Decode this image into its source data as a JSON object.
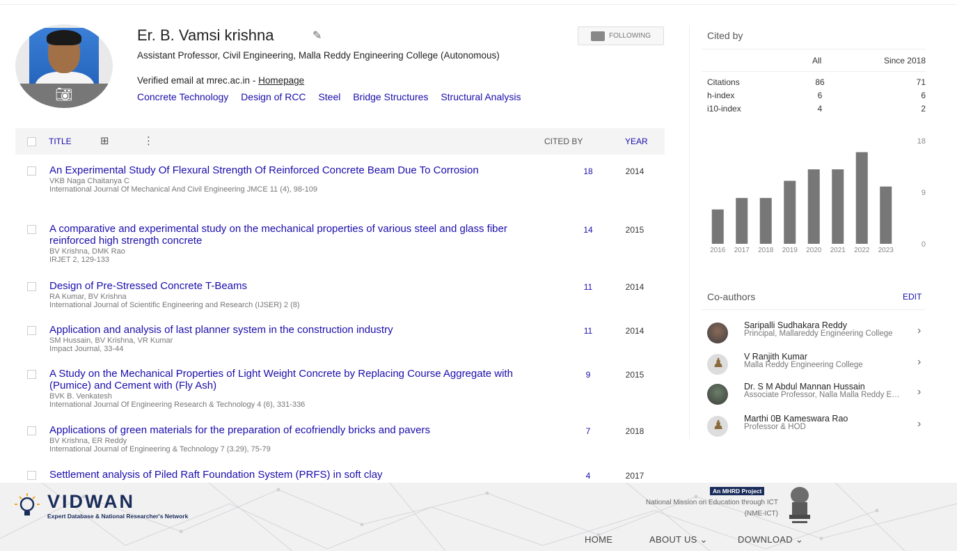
{
  "profile": {
    "name": "Er. B. Vamsi krishna",
    "affiliation": "Assistant Professor, Civil Engineering, Malla Reddy Engineering College (Autonomous)",
    "email_prefix": "Verified email at mrec.ac.in - ",
    "homepage_label": "Homepage",
    "interests": [
      "Concrete Technology",
      "Design of RCC",
      "Steel",
      "Bridge Structures",
      "Structural Analysis"
    ],
    "follow_label": "FOLLOWING"
  },
  "table": {
    "headers": {
      "title": "TITLE",
      "cited_by": "CITED BY",
      "year": "YEAR"
    },
    "rows": [
      {
        "title": "An Experimental Study Of Flexural Strength Of Reinforced Concrete Beam Due To Corrosion",
        "authors": "VKB Naga Chaitanya C",
        "venue": "International Journal Of Mechanical And Civil Engineering JMCE 11 (4), 98-109",
        "cited": "18",
        "year": "2014"
      },
      {
        "title": "A comparative and experimental study on the mechanical properties of various steel and glass fiber reinforced high strength concrete",
        "authors": "BV Krishna, DMK Rao",
        "venue": "IRJET 2, 129-133",
        "cited": "14",
        "year": "2015"
      },
      {
        "title": "Design of Pre-Stressed Concrete T-Beams",
        "authors": "RA Kumar, BV Krishna",
        "venue": "International Journal of Scientific Engineering and Research (IJSER) 2 (8)",
        "cited": "11",
        "year": "2014"
      },
      {
        "title": "Application and analysis of last planner system in the construction industry",
        "authors": "SM Hussain, BV Krishna, VR Kumar",
        "venue": "Impact Journal, 33-44",
        "cited": "11",
        "year": "2014"
      },
      {
        "title": "A Study on the Mechanical Properties of Light Weight Concrete by Replacing Course Aggregate with (Pumice) and Cement with (Fly Ash)",
        "authors": "BVK B. Venkatesh",
        "venue": "International Journal Of Engineering Research & Technology 4 (6), 331-336",
        "cited": "9",
        "year": "2015"
      },
      {
        "title": "Applications of green materials for the preparation of ecofriendly bricks and pavers",
        "authors": "BV Krishna, ER Reddy",
        "venue": "International Journal of Engineering & Technology 7 (3.29), 75-79",
        "cited": "7",
        "year": "2018"
      },
      {
        "title": "Settlement analysis of Piled Raft Foundation System (PRFS) in soft clay",
        "authors": "",
        "venue": "",
        "cited": "4",
        "year": "2017"
      }
    ]
  },
  "cited_by": {
    "heading": "Cited by",
    "col_all": "All",
    "col_since": "Since 2018",
    "rows": [
      {
        "label": "Citations",
        "all": "86",
        "since": "71"
      },
      {
        "label": "h-index",
        "all": "6",
        "since": "6"
      },
      {
        "label": "i10-index",
        "all": "4",
        "since": "2"
      }
    ]
  },
  "chart_data": {
    "type": "bar",
    "categories": [
      "2016",
      "2017",
      "2018",
      "2019",
      "2020",
      "2021",
      "2022",
      "2023"
    ],
    "values": [
      6,
      8,
      8,
      11,
      13,
      13,
      16,
      10
    ],
    "ylim": [
      0,
      18
    ],
    "yticks": [
      "18",
      "9",
      "0"
    ],
    "bar_color": "#777777"
  },
  "coauthors": {
    "heading": "Co-authors",
    "edit_label": "EDIT",
    "items": [
      {
        "name": "Saripalli Sudhakara Reddy",
        "desc": "Principal, Mallareddy Engineering College",
        "avatar": "photo1"
      },
      {
        "name": "V Ranjith Kumar",
        "desc": "Malla Reddy Engineering College",
        "avatar": "generic"
      },
      {
        "name": "Dr. S M Abdul Mannan Hussain",
        "desc": "Associate Professor, Nalla Malla Reddy Engineering College",
        "avatar": "photo2"
      },
      {
        "name": "Marthi 0B Kameswara Rao",
        "desc": "Professor & HOD",
        "avatar": "generic"
      }
    ]
  },
  "footer": {
    "logo_word": "VIDWAN",
    "logo_tagline": "Expert Database & National Researcher's Network",
    "mhrd_badge": "An MHRD Project",
    "nme_line1": "National Mission on Education through ICT",
    "nme_line2": "(NME-ICT)",
    "nav": [
      "HOME",
      "ABOUT US",
      "DOWNLOAD"
    ]
  }
}
